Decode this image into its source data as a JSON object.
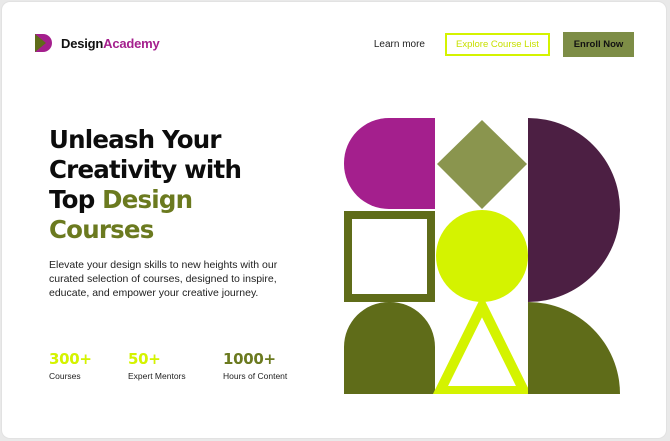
{
  "brand": {
    "name_part1": "Design",
    "name_part2": "Academy",
    "logo_icon": "play-flag-icon"
  },
  "nav": {
    "learn_more": "Learn more",
    "explore": "Explore Course List",
    "enroll": "Enroll Now"
  },
  "hero": {
    "headline_line1": "Unleash Your",
    "headline_line2": "Creativity with",
    "headline_line3_plain": "Top ",
    "headline_line3_accent": "Design",
    "headline_line4_accent": "Courses",
    "subtext": "Elevate your design skills to new heights with our curated selection of courses, designed to inspire, educate, and empower your creative journey."
  },
  "stats": [
    {
      "value": "300+",
      "label": "Courses",
      "color": "#d4f300"
    },
    {
      "value": "50+",
      "label": "Expert Mentors",
      "color": "#d4f300"
    },
    {
      "value": "1000+",
      "label": "Hours of Content",
      "color": "#6b7a1f"
    }
  ],
  "colors": {
    "magenta": "#a41f8d",
    "olive_light": "#8a954e",
    "plum": "#4c1f43",
    "olive_dark": "#5f6c19",
    "lime": "#d4f300",
    "enroll_bg": "#7d8d46"
  }
}
